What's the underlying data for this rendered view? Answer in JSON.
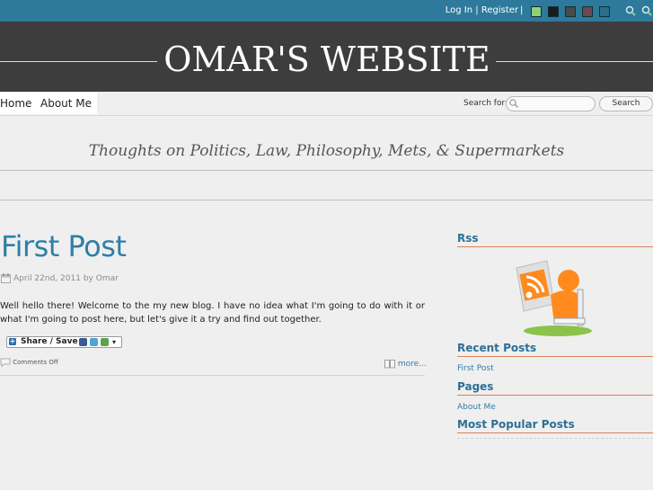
{
  "topbar": {
    "login_label": "Log In",
    "separator": "|",
    "register_label": "Register",
    "bar_separator": "|",
    "color_swatches": [
      "#8fd07a",
      "#1b1b1b",
      "#4a4a4a",
      "#6a4a50",
      "#2b6f8a"
    ],
    "tools": [
      "zoom-in-icon",
      "zoom-out-icon"
    ]
  },
  "header": {
    "title": "OMAR'S WEBSITE"
  },
  "nav": {
    "items": [
      {
        "label": "Home"
      },
      {
        "label": "About Me"
      }
    ],
    "search_label": "Search for:",
    "search_placeholder": "",
    "search_button": "Search"
  },
  "tagline": "Thoughts on Politics, Law, Philosophy, Mets, & Supermarkets",
  "post": {
    "title": "First Post",
    "date": "April 22nd, 2011",
    "by": "by",
    "author": "Omar",
    "body": "Well hello there!  Welcome to the my new blog.  I have no idea what I'm going to do with it or what I'm going to post here, but let's give it a try and find out together.",
    "share_label": "Share / Save",
    "comments": "Comments Off",
    "more": "more..."
  },
  "sidebar": {
    "rss_heading": "Rss",
    "recent_heading": "Recent Posts",
    "recent_items": [
      "First Post"
    ],
    "pages_heading": "Pages",
    "pages_items": [
      "About Me"
    ],
    "popular_heading": "Most Popular Posts"
  },
  "colors": {
    "topbar": "#2e7a9c",
    "header": "#3d3d3d",
    "link": "#2f7fa7",
    "heading": "#2e6f96",
    "accent_rule": "#d9825a"
  }
}
